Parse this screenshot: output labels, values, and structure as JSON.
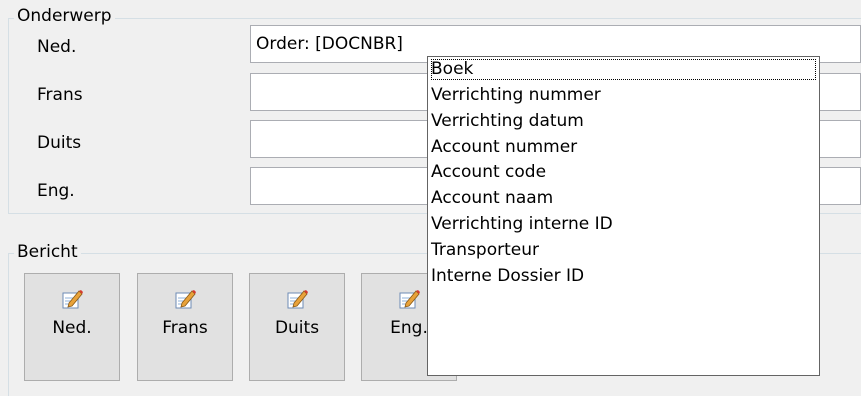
{
  "subject": {
    "legend": "Onderwerp",
    "rows": [
      {
        "label": "Ned.",
        "value": "Order: [DOCNBR]"
      },
      {
        "label": "Frans",
        "value": ""
      },
      {
        "label": "Duits",
        "value": ""
      },
      {
        "label": "Eng.",
        "value": ""
      }
    ]
  },
  "message": {
    "legend": "Bericht",
    "buttons": [
      {
        "label": "Ned.",
        "icon": "edit-pencil-icon"
      },
      {
        "label": "Frans",
        "icon": "edit-pencil-icon"
      },
      {
        "label": "Duits",
        "icon": "edit-pencil-icon"
      },
      {
        "label": "Eng.",
        "icon": "edit-pencil-icon"
      }
    ]
  },
  "dropdown": {
    "items": [
      "Boek",
      "Verrichting nummer",
      "Verrichting datum",
      "Account nummer",
      "Account code",
      "Account naam",
      "Verrichting interne ID",
      "Transporteur",
      "Interne Dossier ID"
    ],
    "focused_index": 0
  },
  "colors": {
    "window_bg": "#f0f0f0",
    "button_bg": "#e1e1e1",
    "field_border": "#abadb3",
    "group_border": "#d5dfe5"
  }
}
